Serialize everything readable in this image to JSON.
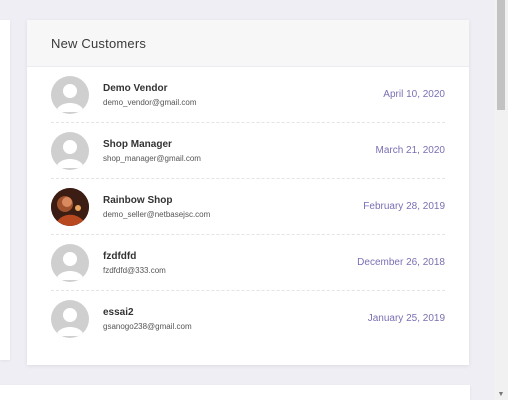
{
  "card": {
    "title": "New Customers"
  },
  "customers": [
    {
      "name": "Demo Vendor",
      "email": "demo_vendor@gmail.com",
      "date": "April 10, 2020",
      "avatar": "default-user-icon"
    },
    {
      "name": "Shop Manager",
      "email": "shop_manager@gmail.com",
      "date": "March 21, 2020",
      "avatar": "default-user-icon"
    },
    {
      "name": "Rainbow Shop",
      "email": "demo_seller@netbasejsc.com",
      "date": "February 28, 2019",
      "avatar": "photo"
    },
    {
      "name": "fzdfdfd",
      "email": "fzdfdfd@333.com",
      "date": "December 26, 2018",
      "avatar": "default-user-icon"
    },
    {
      "name": "essai2",
      "email": "gsanogo238@gmail.com",
      "date": "January 25, 2019",
      "avatar": "default-user-icon"
    }
  ],
  "colors": {
    "date": "#7a6fb3",
    "avatar_bg": "#cfcfcf"
  }
}
